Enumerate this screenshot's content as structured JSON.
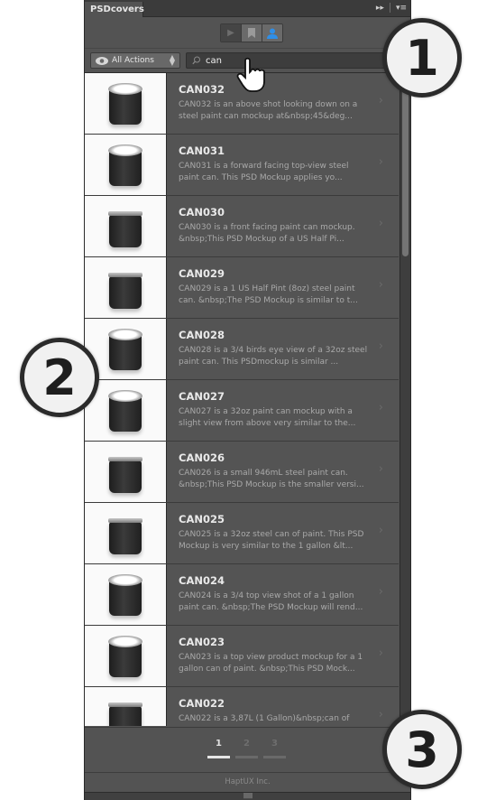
{
  "panel": {
    "tab_label": "PSDcovers",
    "tab_controls": {
      "collapse_icon": "double-chevron-right",
      "menu_icon": "panel-menu"
    }
  },
  "mode_buttons": [
    {
      "name": "play",
      "icon": "play-icon",
      "active": false
    },
    {
      "name": "bookmarks",
      "icon": "bookmark-icon",
      "active": false
    },
    {
      "name": "user",
      "icon": "user-icon",
      "active": true
    }
  ],
  "filter": {
    "select_value": "All Actions",
    "search_value": "can",
    "search_placeholder": ""
  },
  "items": [
    {
      "title": "CAN032",
      "desc": "CAN032 is an above shot looking down on a steel paint can mockup at&nbsp;45&deg...",
      "view": "top"
    },
    {
      "title": "CAN031",
      "desc": "CAN031 is a forward facing top-view steel paint can. This PSD Mockup applies yo...",
      "view": "top"
    },
    {
      "title": "CAN030",
      "desc": "CAN030 is a front facing paint can mockup. &nbsp;This PSD Mockup of a US Half Pi...",
      "view": "front"
    },
    {
      "title": "CAN029",
      "desc": "CAN029 is a 1 US Half Pint (8oz) steel paint can. &nbsp;The PSD Mockup is similar to t...",
      "view": "front"
    },
    {
      "title": "CAN028",
      "desc": "CAN028 is a 3/4 birds eye view of a 32oz steel paint can. This PSDmockup is similar ...",
      "view": "top"
    },
    {
      "title": "CAN027",
      "desc": "CAN027 is a 32oz paint can mockup with a slight view from above very similar to the...",
      "view": "top"
    },
    {
      "title": "CAN026",
      "desc": "CAN026 is a small 946mL steel paint can. &nbsp;This PSD Mockup is the smaller versi...",
      "view": "front"
    },
    {
      "title": "CAN025",
      "desc": "CAN025 is a 32oz steel can of paint. This PSD Mockup is very similar to the 1 gallon &lt...",
      "view": "front"
    },
    {
      "title": "CAN024",
      "desc": "CAN024 is a 3/4 top view shot of a 1 gallon paint can. &nbsp;The PSD Mockup will rend...",
      "view": "top"
    },
    {
      "title": "CAN023",
      "desc": "CAN023 is a top view product mockup for a 1 gallon can of paint. &nbsp;This PSD Mock...",
      "view": "top"
    },
    {
      "title": "CAN022",
      "desc": "CAN022 is a 3,87L (1 Gallon)&nbsp;can of",
      "view": "front"
    }
  ],
  "pagination": {
    "pages": [
      "1",
      "2",
      "3"
    ],
    "current": "1"
  },
  "footer": {
    "text": "HaptUX Inc."
  },
  "callouts": [
    "1",
    "2",
    "3"
  ],
  "colors": {
    "panel_bg": "#535353",
    "active_user_icon": "#2f8fe8",
    "thumb_bg": "#fafafa"
  }
}
